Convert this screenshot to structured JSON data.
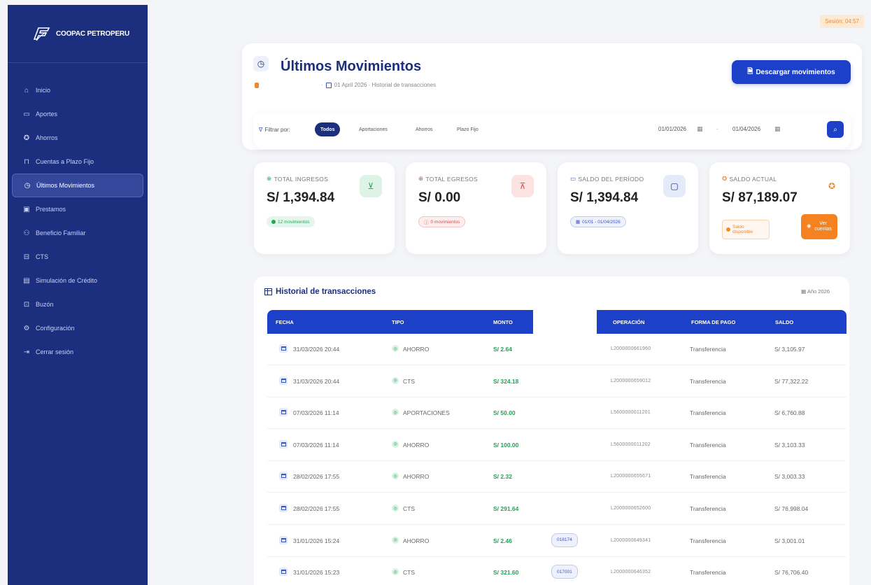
{
  "brand": {
    "name": "COOPAC PETROPERU"
  },
  "sidebar": {
    "items": [
      {
        "label": "Inicio",
        "icon": "home-icon",
        "glyph": "⌂"
      },
      {
        "label": "Aportes",
        "icon": "wallet-icon",
        "glyph": "▭"
      },
      {
        "label": "Ahorros",
        "icon": "piggy-icon",
        "glyph": "✪"
      },
      {
        "label": "Cuentas a Plazo Fijo",
        "icon": "lock-icon",
        "glyph": "⊓"
      },
      {
        "label": "Últimos Movimientos",
        "icon": "clock-icon",
        "glyph": "◷",
        "active": true
      },
      {
        "label": "Prestamos",
        "icon": "money-icon",
        "glyph": "▣"
      },
      {
        "label": "Beneficio Familiar",
        "icon": "users-icon",
        "glyph": "⚇"
      },
      {
        "label": "CTS",
        "icon": "briefcase-icon",
        "glyph": "⊟"
      },
      {
        "label": "Simulación de Crédito",
        "icon": "calculator-icon",
        "glyph": "▤"
      },
      {
        "label": "Buzón",
        "icon": "inbox-icon",
        "glyph": "⊡"
      },
      {
        "label": "Configuración",
        "icon": "gear-icon",
        "glyph": "⚙"
      },
      {
        "label": "Cerrar sesión",
        "icon": "logout-icon",
        "glyph": "⇥"
      }
    ]
  },
  "session": {
    "label": "Sesión: 04:57"
  },
  "header": {
    "title": "Últimos Movimientos",
    "subtitle_sep": "·",
    "subtitle": "01 April 2026 · Historial de transacciones",
    "download_label": "Descargar movimientos"
  },
  "filters": {
    "label": "Filtrar por:",
    "options": [
      "Todos",
      "Aportaciones",
      "Ahorros",
      "Plazo Fijo"
    ],
    "date_from": "01/01/2026",
    "date_sep": "-",
    "date_to": "01/04/2026"
  },
  "stats": {
    "ingresos": {
      "label": "TOTAL INGRESOS",
      "value": "S/ 1,394.84",
      "badge": "12 movimientos",
      "color": "#2aa45a"
    },
    "egresos": {
      "label": "TOTAL EGRESOS",
      "value": "S/ 0.00",
      "badge": "0 movimientos",
      "color": "#e04848"
    },
    "periodo": {
      "label": "SALDO DEL PERÍODO",
      "value": "S/ 1,394.84",
      "badge": "01/01 - 01/04/2026",
      "color": "#3a55c0"
    },
    "actual": {
      "label": "SALDO ACTUAL",
      "value": "S/ 87,189.07",
      "saldo_line1": "Saldo",
      "saldo_line2": "disponible",
      "ver_line1": "Ver",
      "ver_line2": "cuentas",
      "color": "#f08a2a"
    }
  },
  "history": {
    "title": "Historial de transacciones",
    "year": "Año 2026",
    "columns": {
      "fecha": "FECHA",
      "tipo": "TIPO",
      "monto": "MONTO",
      "operacion": "OPERACIÓN",
      "forma": "FORMA DE PAGO",
      "saldo": "SALDO"
    },
    "rows": [
      {
        "fecha": "31/03/2026 20:44",
        "tipo": "AHORRO",
        "monto": "S/ 2.64",
        "ref": "",
        "operacion": "L2000000661960",
        "forma": "Transferencia",
        "saldo": "S/ 3,105.97"
      },
      {
        "fecha": "31/03/2026 20:44",
        "tipo": "CTS",
        "monto": "S/ 324.18",
        "ref": "",
        "operacion": "L2000000659012",
        "forma": "Transferencia",
        "saldo": "S/ 77,322.22"
      },
      {
        "fecha": "07/03/2026 11:14",
        "tipo": "APORTACIONES",
        "monto": "S/ 50.00",
        "ref": "",
        "operacion": "L5600000011201",
        "forma": "Transferencia",
        "saldo": "S/ 6,760.88"
      },
      {
        "fecha": "07/03/2026 11:14",
        "tipo": "AHORRO",
        "monto": "S/ 100.00",
        "ref": "",
        "operacion": "L5600000011202",
        "forma": "Transferencia",
        "saldo": "S/ 3,103.33"
      },
      {
        "fecha": "28/02/2026 17:55",
        "tipo": "AHORRO",
        "monto": "S/ 2.32",
        "ref": "",
        "operacion": "L2000000655671",
        "forma": "Transferencia",
        "saldo": "S/ 3,003.33"
      },
      {
        "fecha": "28/02/2026 17:55",
        "tipo": "CTS",
        "monto": "S/ 291.64",
        "ref": "",
        "operacion": "L2000000652600",
        "forma": "Transferencia",
        "saldo": "S/ 76,998.04"
      },
      {
        "fecha": "31/01/2026 15:24",
        "tipo": "AHORRO",
        "monto": "S/ 2.46",
        "ref": "018174",
        "operacion": "L2000000649341",
        "forma": "Transferencia",
        "saldo": "S/ 3,001.01"
      },
      {
        "fecha": "31/01/2026 15:23",
        "tipo": "CTS",
        "monto": "S/ 321.60",
        "ref": "017001",
        "operacion": "L2000000646352",
        "forma": "Transferencia",
        "saldo": "S/ 76,706.40"
      }
    ]
  }
}
